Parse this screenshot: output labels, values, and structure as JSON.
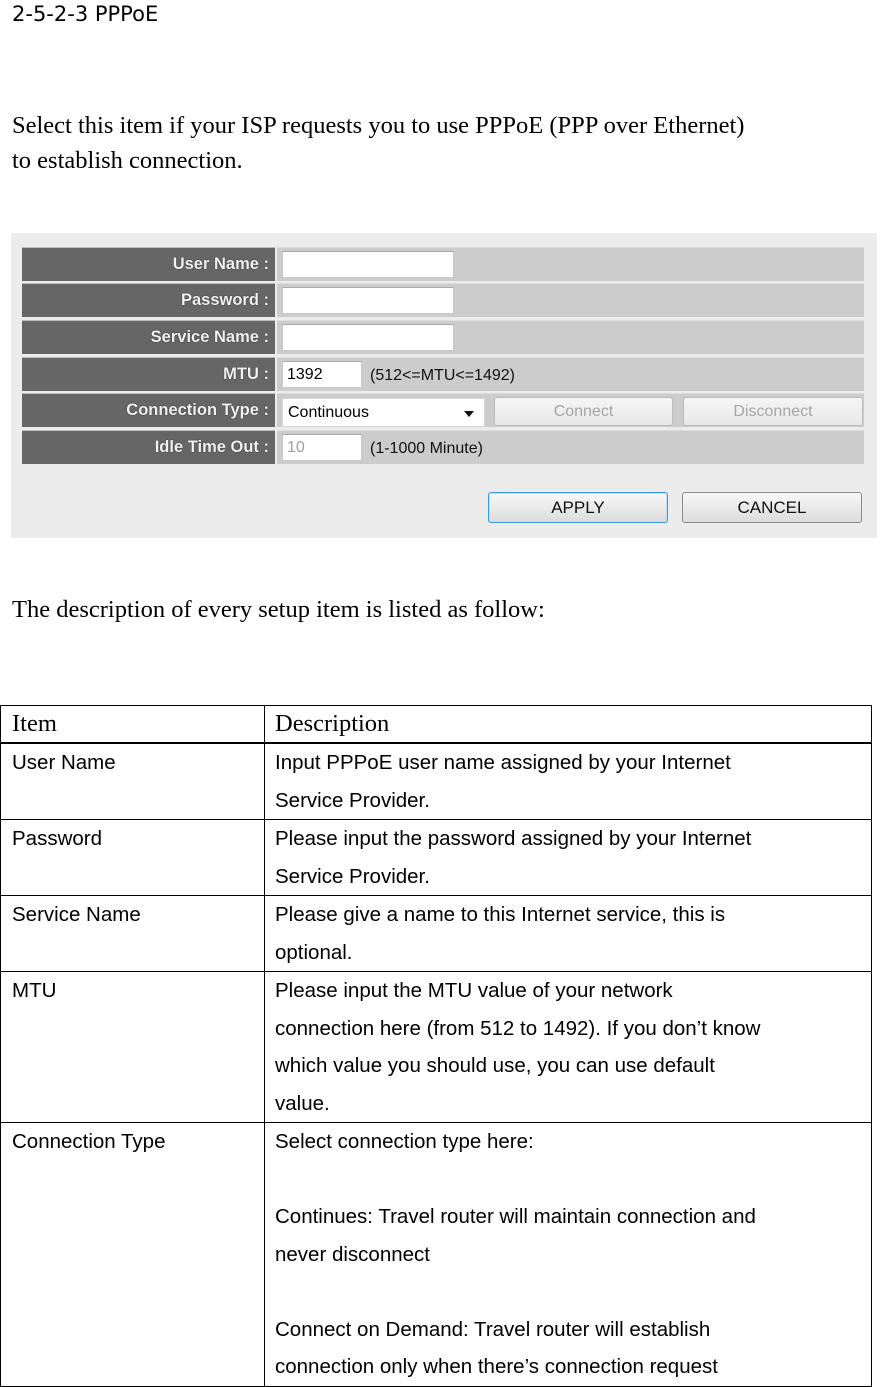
{
  "section_heading": "2-5-2-3 PPPoE",
  "intro_lines": [
    "Select this item if your ISP requests you to use PPPoE (PPP over Ethernet)",
    "to establish connection."
  ],
  "router_form": {
    "rows": [
      {
        "label": "User Name :",
        "value": ""
      },
      {
        "label": "Password :",
        "value": ""
      },
      {
        "label": "Service Name :",
        "value": ""
      },
      {
        "label": "MTU :",
        "value": "1392",
        "hint": "(512<=MTU<=1492)"
      },
      {
        "label": "Connection Type :",
        "selected": "Continuous",
        "connect_label": "Connect",
        "disconnect_label": "Disconnect"
      },
      {
        "label": "Idle Time Out :",
        "value": "10",
        "hint": "(1-1000 Minute)"
      }
    ],
    "apply_label": "APPLY",
    "cancel_label": "CANCEL"
  },
  "description_intro": "The description of every setup item is listed as follow:",
  "table": {
    "headers": [
      "Item",
      "Description"
    ],
    "rows": [
      {
        "item": "User Name",
        "desc": [
          "Input PPPoE user name assigned by your Internet",
          "Service Provider."
        ]
      },
      {
        "item": "Password",
        "desc": [
          "Please input the password assigned by your Internet",
          "Service Provider."
        ]
      },
      {
        "item": "Service Name",
        "desc": [
          "Please give a name to this Internet service, this is",
          "optional."
        ]
      },
      {
        "item": "MTU",
        "desc": [
          "Please input the MTU value of your network",
          "connection here (from 512 to 1492). If you don’t know",
          "which value you should use, you can use default",
          "value."
        ]
      },
      {
        "item": "Connection Type",
        "desc": [
          "Select connection type here:",
          "",
          "Continues: Travel router will maintain connection and",
          "never disconnect",
          "",
          "Connect on Demand: Travel router will establish",
          "connection only when there’s connection request"
        ]
      }
    ]
  }
}
